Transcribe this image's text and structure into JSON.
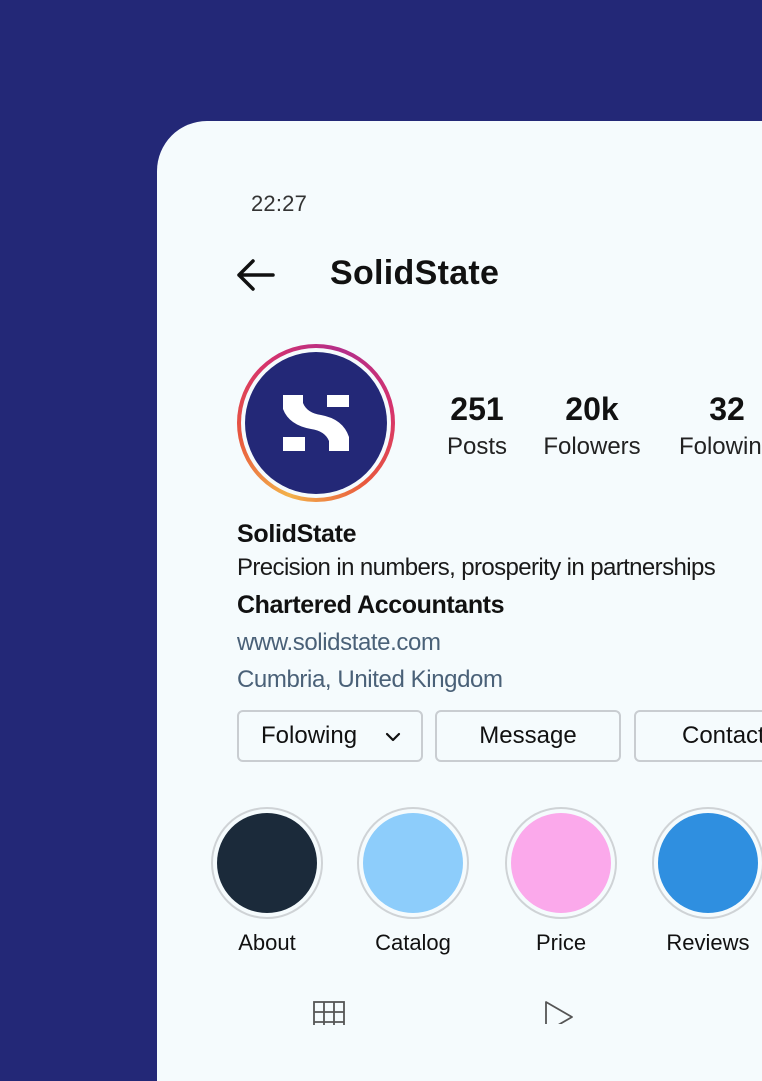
{
  "status_bar": {
    "time": "22:27"
  },
  "header": {
    "title": "SolidState",
    "back_icon": "arrow-left-icon"
  },
  "profile": {
    "avatar_icon": "solidstate-logo",
    "stats": [
      {
        "value": "251",
        "label": "Posts"
      },
      {
        "value": "20k",
        "label": "Folowers"
      },
      {
        "value": "32",
        "label": "Folowing"
      }
    ],
    "name": "SolidState",
    "tagline": "Precision in numbers, prosperity in partnerships",
    "category": "Chartered Accountants",
    "website": "www.solidstate.com",
    "location": "Cumbria, United Kingdom"
  },
  "actions": {
    "following_label": "Folowing",
    "following_icon": "chevron-down-icon",
    "message_label": "Message",
    "contact_label": "Contact"
  },
  "highlights": [
    {
      "label": "About",
      "color": "#1b2a3a"
    },
    {
      "label": "Catalog",
      "color": "#8dcdfb"
    },
    {
      "label": "Price",
      "color": "#fba9eb"
    },
    {
      "label": "Reviews",
      "color": "#2f8fe0"
    }
  ],
  "tab_bar": {
    "icons": [
      "grid-icon",
      "reels-icon"
    ]
  },
  "colors": {
    "background": "#232877",
    "card": "#f5fbfd",
    "link": "#4a6178",
    "brand": "#232877"
  }
}
